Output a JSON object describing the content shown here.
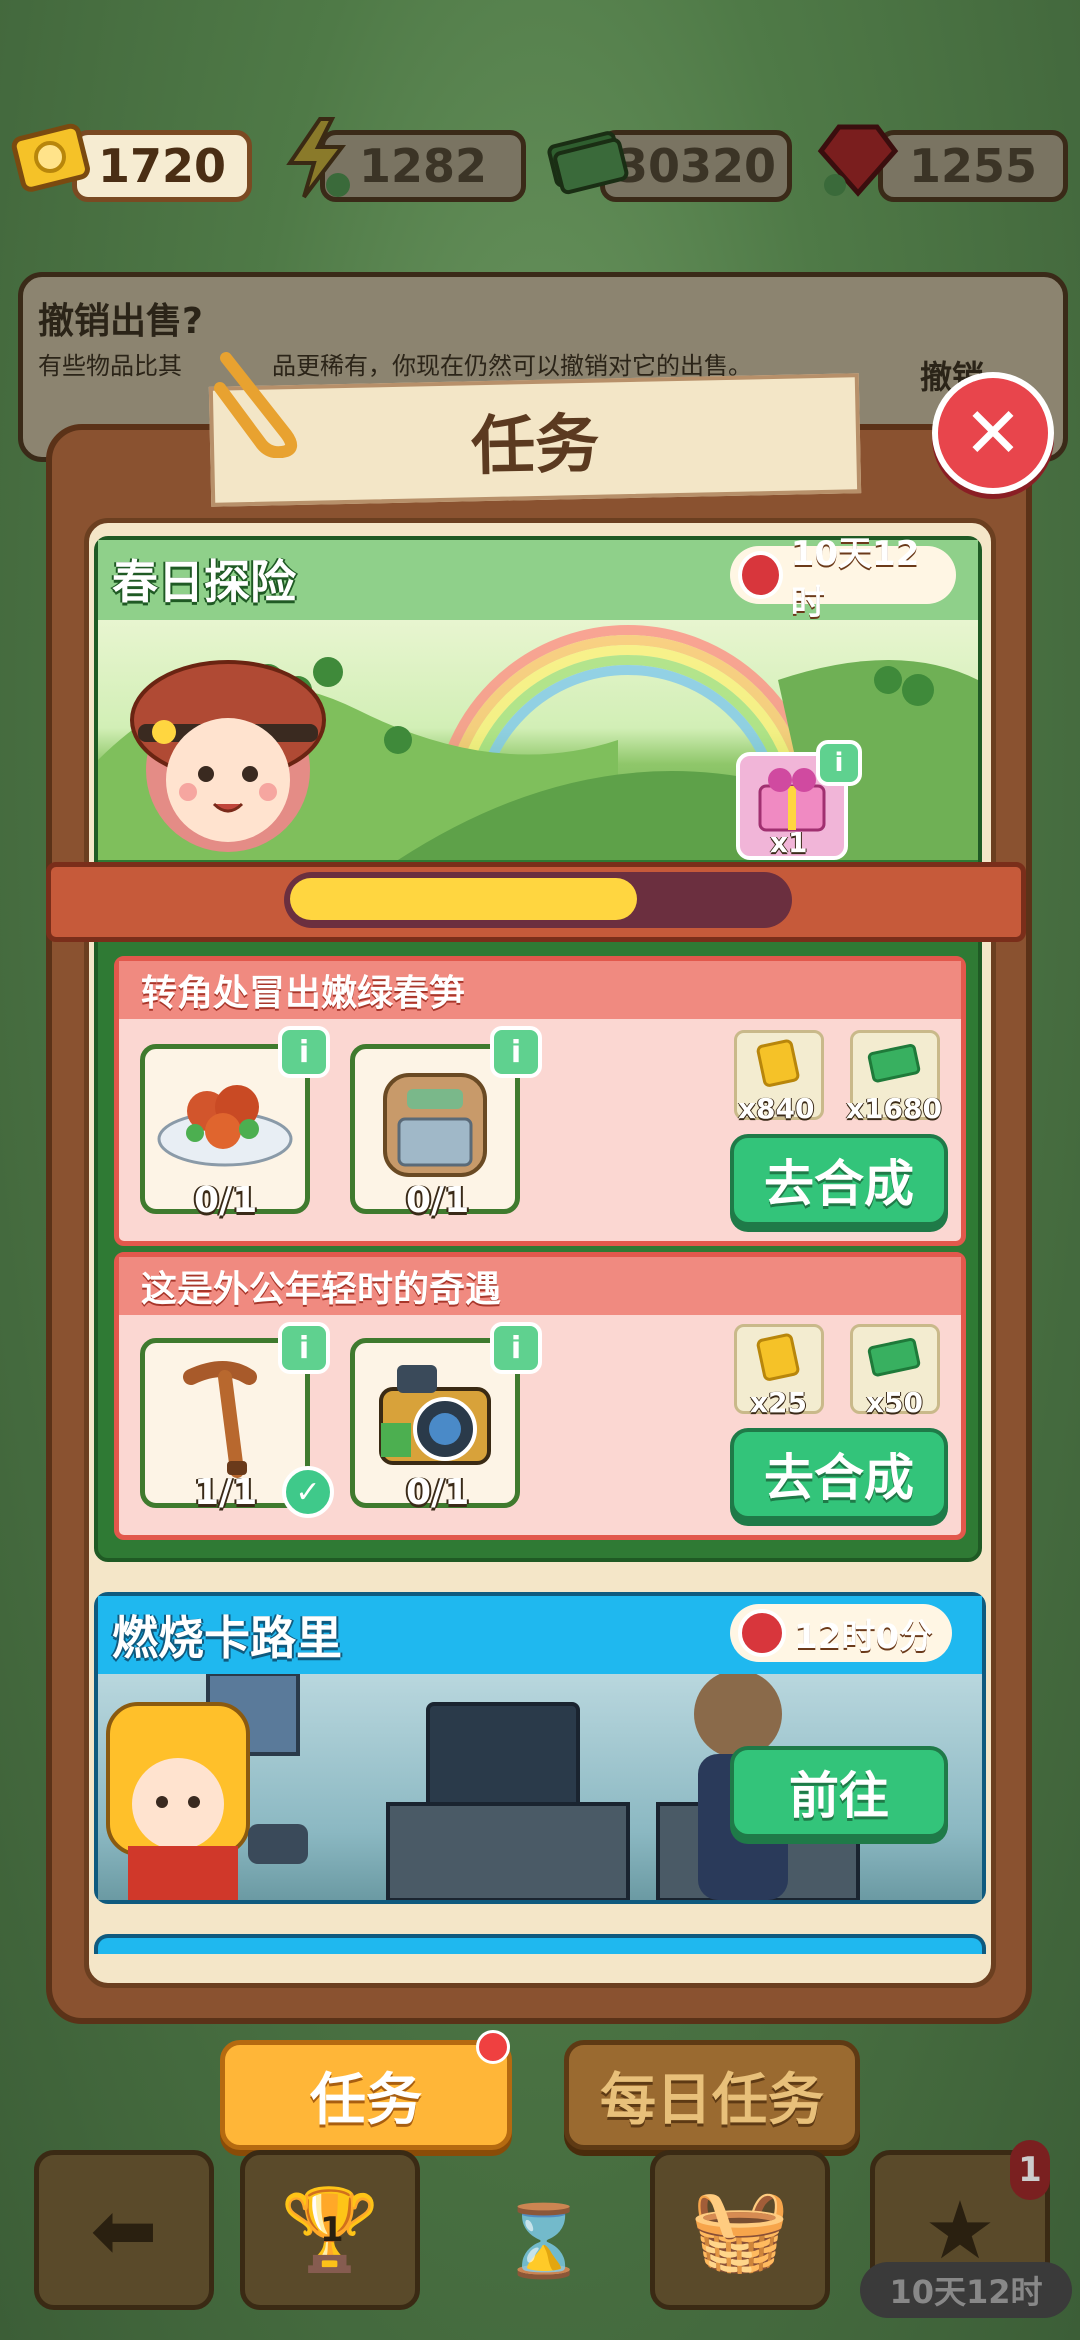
{
  "currencies": [
    {
      "name": "ticket",
      "value": "1720"
    },
    {
      "name": "energy",
      "value": "1282"
    },
    {
      "name": "cash",
      "value": "30320"
    },
    {
      "name": "gem",
      "value": "1255"
    }
  ],
  "background_popup": {
    "title": "撤销出售?",
    "subtitle": "有些物品比其",
    "subtitle_tail": "品更稀有，你现在仍然可以撤销对它的出售。",
    "right": "撤销"
  },
  "panel": {
    "title": "任务",
    "close_icon": "close-icon"
  },
  "quest1": {
    "name": "春日探险",
    "timer": "10天12时",
    "reward_count": "x1",
    "progress": 0.7,
    "tasks": [
      {
        "title": "转角处冒出嫩绿春笋",
        "items": [
          {
            "icon": "food-plate-icon",
            "count": "0/1"
          },
          {
            "icon": "backpack-icon",
            "count": "0/1"
          }
        ],
        "rewards": [
          {
            "icon": "ticket-icon",
            "count": "x840"
          },
          {
            "icon": "cash-icon",
            "count": "x1680"
          }
        ],
        "button": "去合成"
      },
      {
        "title": "这是外公年轻时的奇遇",
        "items": [
          {
            "icon": "cane-icon",
            "count": "1/1",
            "done": true
          },
          {
            "icon": "camera-icon",
            "count": "0/1"
          }
        ],
        "rewards": [
          {
            "icon": "ticket-icon",
            "count": "x25"
          },
          {
            "icon": "cash-icon",
            "count": "x50"
          }
        ],
        "button": "去合成"
      }
    ]
  },
  "quest2": {
    "name": "燃烧卡路里",
    "timer": "12时0分",
    "button": "前往"
  },
  "tabs": {
    "active": "任务",
    "inactive": "每日任务"
  },
  "bottom_nav": {
    "trophy_badge": "1",
    "star_badge": "1",
    "timer": "10天12时"
  },
  "colors": {
    "accent_orange": "#ffb638",
    "green_button": "#33c47a",
    "close_red": "#e8454c"
  }
}
